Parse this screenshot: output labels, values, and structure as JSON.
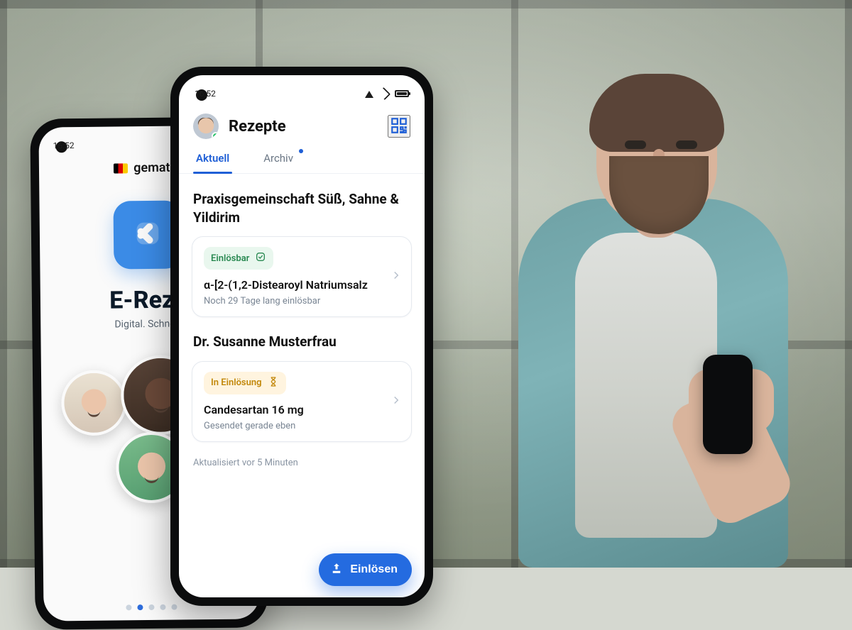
{
  "status": {
    "time": "16:52"
  },
  "back_phone": {
    "brand": "gematik",
    "title": "E-Reze",
    "subtitle": "Digital. Schnell.",
    "pager_count": 5,
    "pager_active_index": 1
  },
  "header": {
    "title": "Rezepte"
  },
  "tabs": {
    "active": "Aktuell",
    "items": [
      {
        "label": "Aktuell",
        "has_dot": false
      },
      {
        "label": "Archiv",
        "has_dot": true
      }
    ]
  },
  "sections": [
    {
      "practice": "Praxisgemeinschaft Süß, Sahne & Yildirim",
      "status_kind": "green",
      "status_label": "Einlösbar",
      "med_name": "α-[2-(1,2-Distearoyl Natriumsalz",
      "meta": "Noch 29 Tage lang einlösbar"
    },
    {
      "practice": "Dr. Susanne Musterfrau",
      "status_kind": "amber",
      "status_label": "In Einlösung",
      "med_name": "Candesartan 16 mg",
      "meta": "Gesendet gerade eben"
    }
  ],
  "updated_label": "Aktualisiert vor 5 Minuten",
  "fab_label": "Einlösen",
  "colors": {
    "primary": "#246be0",
    "green": "#2b8a53",
    "amber": "#c2880b"
  }
}
